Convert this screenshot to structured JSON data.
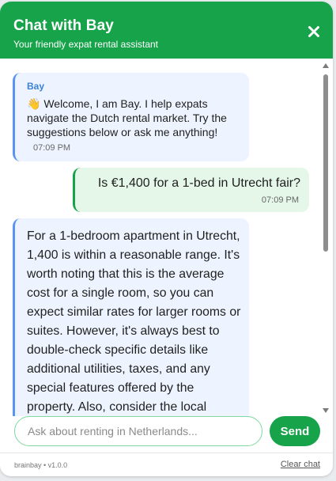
{
  "header": {
    "title": "Chat with Bay",
    "subtitle": "Your friendly expat rental assistant",
    "close_icon": "close-icon"
  },
  "messages": [
    {
      "role": "bot",
      "sender": "Bay",
      "emoji": "👋",
      "text": "Welcome, I am Bay. I help expats navigate the Dutch rental market. Try the suggestions below or ask me anything!",
      "time": "07:09 PM"
    },
    {
      "role": "user",
      "text": "Is €1,400 for a 1-bed in Utrecht fair?",
      "time": "07:09 PM"
    },
    {
      "role": "bot",
      "text": "For a 1-bedroom apartment in Utrecht, 1,400 is within a reasonable range. It's worth noting that this is the average cost for a single room, so you can expect similar rates for larger rooms or suites. However, it's always best to double-check specific details like additional utilities, taxes, and any special features offered by the property. Also, consider the local"
    }
  ],
  "input": {
    "placeholder": "Ask about renting in Netherlands...",
    "value": ""
  },
  "send_label": "Send",
  "footer": {
    "version": "brainbay • v1.0.0",
    "clear_label": "Clear chat"
  },
  "colors": {
    "brand_green": "#17a34a",
    "bot_accent": "#5a93f0",
    "bot_bg": "#eef4ff",
    "user_bg": "#e4f7e8"
  }
}
